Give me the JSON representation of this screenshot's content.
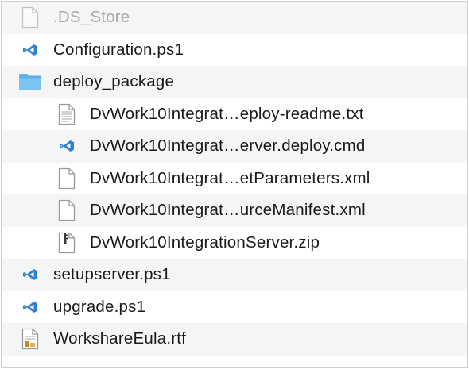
{
  "files": [
    {
      "name": ".DS_Store",
      "icon": "blank-document-icon",
      "level": 0,
      "dim": true
    },
    {
      "name": "Configuration.ps1",
      "icon": "vscode-file-icon",
      "level": 0
    },
    {
      "name": "deploy_package",
      "icon": "folder-icon",
      "level": 0
    },
    {
      "name": "DvWork10Integrat…eploy-readme.txt",
      "icon": "text-document-icon",
      "level": 1
    },
    {
      "name": "DvWork10Integrat…erver.deploy.cmd",
      "icon": "vscode-file-icon",
      "level": 1
    },
    {
      "name": "DvWork10Integrat…etParameters.xml",
      "icon": "blank-document-icon",
      "level": 1
    },
    {
      "name": "DvWork10Integrat…urceManifest.xml",
      "icon": "blank-document-icon",
      "level": 1
    },
    {
      "name": "DvWork10IntegrationServer.zip",
      "icon": "zip-archive-icon",
      "level": 1
    },
    {
      "name": "setupserver.ps1",
      "icon": "vscode-file-icon",
      "level": 0
    },
    {
      "name": "upgrade.ps1",
      "icon": "vscode-file-icon",
      "level": 0
    },
    {
      "name": "WorkshareEula.rtf",
      "icon": "rich-text-document-icon",
      "level": 0
    }
  ],
  "colors": {
    "row_alt": "#f4f5f5",
    "folder": "#5fb0e8",
    "vscode": "#2f80d1",
    "text_dim": "#a9a9a9"
  }
}
